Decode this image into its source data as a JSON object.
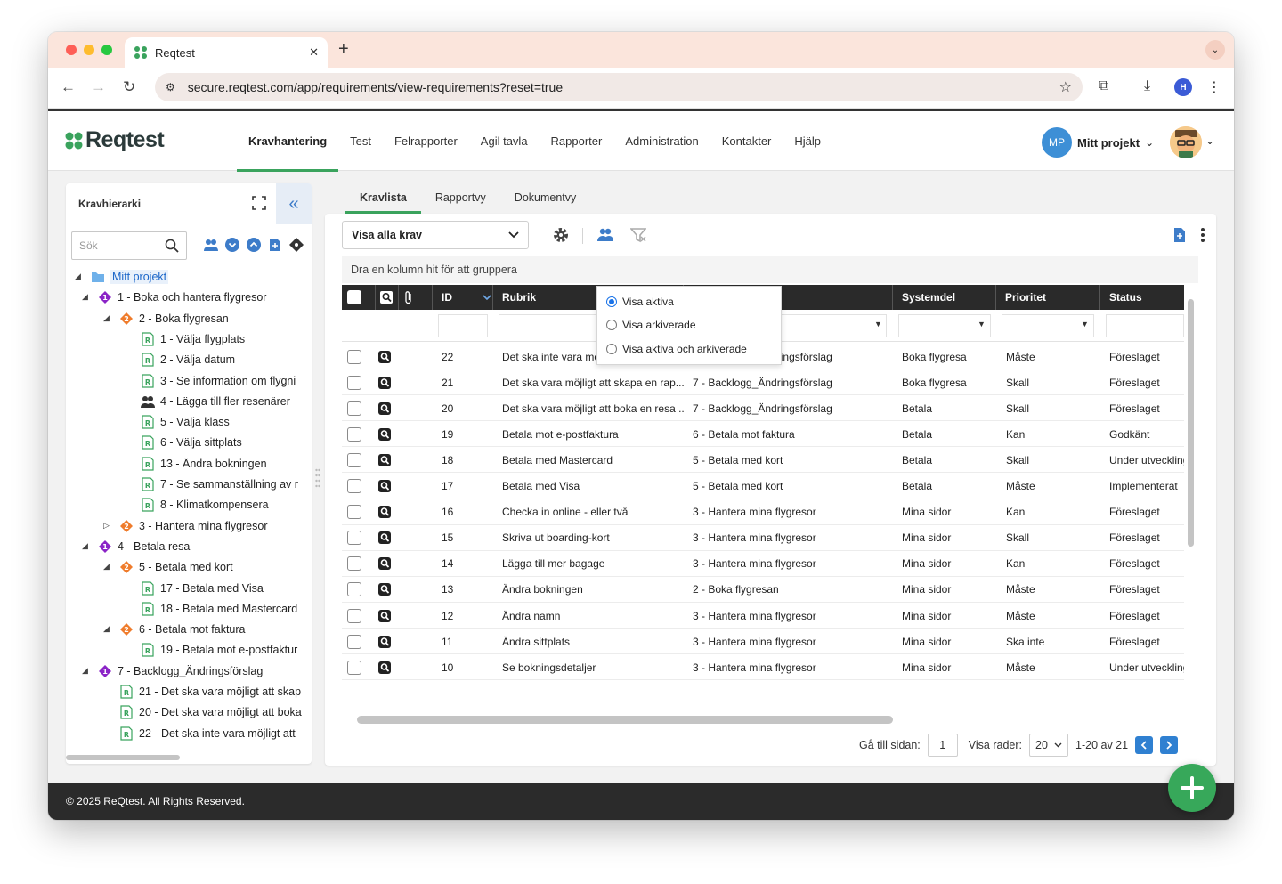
{
  "browser": {
    "tab_title": "Reqtest",
    "url": "secure.reqtest.com/app/requirements/view-requirements?reset=true",
    "profile_initial": "H"
  },
  "app": {
    "logo_text": "Reqtest",
    "nav": [
      {
        "label": "Kravhantering",
        "active": true
      },
      {
        "label": "Test"
      },
      {
        "label": "Felrapporter"
      },
      {
        "label": "Agil tavla"
      },
      {
        "label": "Rapporter"
      },
      {
        "label": "Administration"
      },
      {
        "label": "Kontakter"
      },
      {
        "label": "Hjälp"
      }
    ],
    "project_initials": "MP",
    "project_name": "Mitt projekt"
  },
  "left_panel": {
    "title": "Kravhierarki",
    "search_placeholder": "Sök",
    "tree": [
      {
        "label": "Mitt projekt",
        "type": "folder",
        "level": 0
      },
      {
        "label": "1 - Boka och hantera flygresor",
        "type": "epic",
        "level": 1
      },
      {
        "label": "2 - Boka flygresan",
        "type": "feature",
        "level": 2
      },
      {
        "label": "1 - Välja flygplats",
        "type": "req",
        "level": 3
      },
      {
        "label": "2 - Välja datum",
        "type": "req",
        "level": 3
      },
      {
        "label": "3 - Se information om flygni",
        "type": "req",
        "level": 3
      },
      {
        "label": "4 - Lägga till fler resenärer",
        "type": "people",
        "level": 3
      },
      {
        "label": "5 - Välja klass",
        "type": "req",
        "level": 3
      },
      {
        "label": "6 - Välja sittplats",
        "type": "req",
        "level": 3
      },
      {
        "label": "13 - Ändra bokningen",
        "type": "req",
        "level": 3
      },
      {
        "label": "7 - Se sammanställning av r",
        "type": "req",
        "level": 3
      },
      {
        "label": "8 - Klimatkompensera",
        "type": "req",
        "level": 3
      },
      {
        "label": "3 - Hantera mina flygresor",
        "type": "feature",
        "level": 2
      },
      {
        "label": "4 - Betala resa",
        "type": "epic",
        "level": 1
      },
      {
        "label": "5 - Betala med kort",
        "type": "feature",
        "level": 2
      },
      {
        "label": "17 - Betala med Visa",
        "type": "req",
        "level": 3
      },
      {
        "label": "18 - Betala med Mastercard",
        "type": "req",
        "level": 3
      },
      {
        "label": "6 - Betala mot faktura",
        "type": "feature",
        "level": 2
      },
      {
        "label": "19 - Betala mot e-postfaktur",
        "type": "req",
        "level": 3
      },
      {
        "label": "7 - Backlogg_Ändringsförslag",
        "type": "epic",
        "level": 1
      },
      {
        "label": "21 - Det ska vara möjligt att skap",
        "type": "req",
        "level": 2
      },
      {
        "label": "20 - Det ska vara möjligt att boka",
        "type": "req",
        "level": 2
      },
      {
        "label": "22 - Det ska inte vara möjligt att",
        "type": "req",
        "level": 2
      }
    ],
    "badge_epic": "1",
    "badge_feature": "2"
  },
  "tabs": [
    {
      "label": "Kravlista",
      "active": true
    },
    {
      "label": "Rapportvy"
    },
    {
      "label": "Dokumentvy"
    }
  ],
  "content": {
    "view_select": "Visa alla krav",
    "group_hint": "Dra en kolumn hit för att gruppera",
    "columns": [
      "ID",
      "Rubrik",
      "",
      "Systemdel",
      "Prioritet",
      "Status"
    ],
    "rows": [
      {
        "id": "22",
        "rubrik": "Det ska inte vara möjligt att boka ett ...",
        "parent": "7 - Backlogg_Ändringsförslag",
        "systemdel": "Boka flygresa",
        "prioritet": "Måste",
        "status": "Föreslaget"
      },
      {
        "id": "21",
        "rubrik": "Det ska vara möjligt att skapa en rap...",
        "parent": "7 - Backlogg_Ändringsförslag",
        "systemdel": "Boka flygresa",
        "prioritet": "Skall",
        "status": "Föreslaget"
      },
      {
        "id": "20",
        "rubrik": "Det ska vara möjligt att boka en resa ...",
        "parent": "7 - Backlogg_Ändringsförslag",
        "systemdel": "Betala",
        "prioritet": "Skall",
        "status": "Föreslaget"
      },
      {
        "id": "19",
        "rubrik": "Betala mot e-postfaktura",
        "parent": "6 - Betala mot faktura",
        "systemdel": "Betala",
        "prioritet": "Kan",
        "status": "Godkänt"
      },
      {
        "id": "18",
        "rubrik": "Betala med Mastercard",
        "parent": "5 - Betala med kort",
        "systemdel": "Betala",
        "prioritet": "Skall",
        "status": "Under utveckling"
      },
      {
        "id": "17",
        "rubrik": "Betala med Visa",
        "parent": "5 - Betala med kort",
        "systemdel": "Betala",
        "prioritet": "Måste",
        "status": "Implementerat"
      },
      {
        "id": "16",
        "rubrik": "Checka in online - eller två",
        "parent": "3 - Hantera mina flygresor",
        "systemdel": "Mina sidor",
        "prioritet": "Kan",
        "status": "Föreslaget"
      },
      {
        "id": "15",
        "rubrik": "Skriva ut boarding-kort",
        "parent": "3 - Hantera mina flygresor",
        "systemdel": "Mina sidor",
        "prioritet": "Skall",
        "status": "Föreslaget"
      },
      {
        "id": "14",
        "rubrik": "Lägga till mer bagage",
        "parent": "3 - Hantera mina flygresor",
        "systemdel": "Mina sidor",
        "prioritet": "Kan",
        "status": "Föreslaget"
      },
      {
        "id": "13",
        "rubrik": "Ändra bokningen",
        "parent": "2 - Boka flygresan",
        "systemdel": "Mina sidor",
        "prioritet": "Måste",
        "status": "Föreslaget"
      },
      {
        "id": "12",
        "rubrik": "Ändra namn",
        "parent": "3 - Hantera mina flygresor",
        "systemdel": "Mina sidor",
        "prioritet": "Måste",
        "status": "Föreslaget"
      },
      {
        "id": "11",
        "rubrik": "Ändra sittplats",
        "parent": "3 - Hantera mina flygresor",
        "systemdel": "Mina sidor",
        "prioritet": "Ska inte",
        "status": "Föreslaget"
      },
      {
        "id": "10",
        "rubrik": "Se bokningsdetaljer",
        "parent": "3 - Hantera mina flygresor",
        "systemdel": "Mina sidor",
        "prioritet": "Måste",
        "status": "Under utveckling"
      }
    ],
    "archive_menu": [
      {
        "label": "Visa aktiva",
        "checked": true
      },
      {
        "label": "Visa arkiverade",
        "checked": false
      },
      {
        "label": "Visa aktiva och arkiverade",
        "checked": false
      }
    ],
    "pager": {
      "goto_label": "Gå till sidan:",
      "page": "1",
      "rows_label": "Visa rader:",
      "rows_value": "20",
      "range": "1-20 av 21"
    }
  },
  "footer": {
    "copyright": "© 2025 ReQtest. All Rights Reserved."
  },
  "colors": {
    "accent_green": "#3aa35d",
    "accent_blue": "#2f80d1",
    "epic_purple": "#8b24c7",
    "feature_orange": "#ef7c2c"
  }
}
